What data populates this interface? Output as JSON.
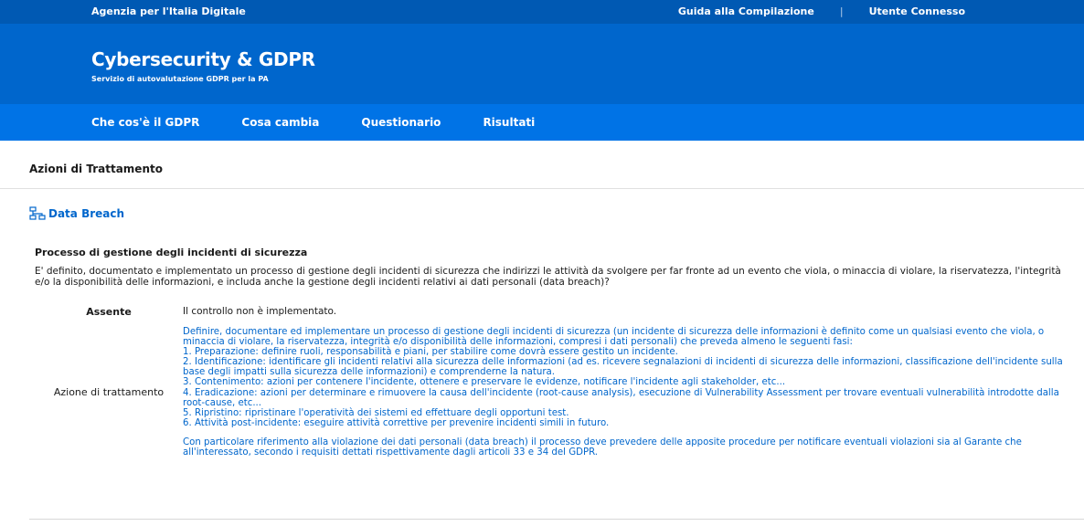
{
  "topbar": {
    "brand": "Agenzia per l'Italia Digitale",
    "guide_link": "Guida alla Compilazione",
    "separator": "|",
    "user_link": "Utente Connesso"
  },
  "header": {
    "title": "Cybersecurity & GDPR",
    "subtitle": "Servizio di autovalutazione GDPR per la PA"
  },
  "nav": {
    "items": [
      "Che cos'è il GDPR",
      "Cosa cambia",
      "Questionario",
      "Risultati"
    ]
  },
  "page": {
    "section_title": "Azioni di Trattamento",
    "breach_link": "Data Breach",
    "icon": "sitemap-icon"
  },
  "question": {
    "title": "Processo di gestione degli incidenti di sicurezza",
    "text": "E' definito, documentato e implementato un processo di gestione degli incidenti di sicurezza che indirizzi le attività da svolgere per far fronte ad un evento che viola, o minaccia di violare, la riservatezza, l'integrità e/o la disponibilità delle informazioni, e includa anche la gestione degli incidenti relativi ai dati personali (data breach)?"
  },
  "status": {
    "label": "Assente",
    "value": "Il controllo non è implementato."
  },
  "action": {
    "label": "Azione di trattamento",
    "lines": [
      "Definire, documentare ed implementare un processo di gestione degli incidenti di sicurezza (un incidente di sicurezza delle informazioni è definito come un qualsiasi evento che viola, o minaccia di violare, la riservatezza, integrità e/o disponibilità delle informazioni, compresi i dati personali) che preveda almeno le seguenti fasi:",
      "1. Preparazione: definire ruoli, responsabilità e piani, per stabilire come dovrà essere gestito un incidente.",
      "2. Identificazione: identificare gli incidenti relativi alla sicurezza delle informazioni (ad es. ricevere segnalazioni di incidenti di sicurezza delle informazioni, classificazione dell'incidente sulla base degli impatti sulla sicurezza delle informazioni) e comprenderne la natura.",
      "3. Contenimento: azioni per contenere l'incidente, ottenere e preservare le evidenze, notificare l'incidente agli stakeholder, etc...",
      "4. Eradicazione: azioni per determinare e rimuovere la causa dell'incidente (root-cause analysis), esecuzione di Vulnerability Assessment per trovare eventuali vulnerabilità introdotte dalla root-cause, etc...",
      "5. Ripristino: ripristinare l'operatività dei sistemi ed effettuare degli opportuni test.",
      "6. Attività post-incidente: eseguire attività correttive per prevenire incidenti simili in futuro."
    ],
    "note": "Con particolare riferimento alla violazione dei dati personali (data breach) il processo deve prevedere delle apposite procedure per notificare eventuali violazioni sia al Garante che all'interessato, secondo i requisiti dettati rispettivamente dagli articoli 33 e 34 del GDPR."
  }
}
